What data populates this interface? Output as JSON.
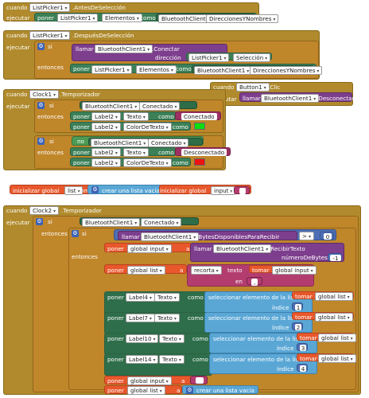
{
  "kw": {
    "cuando": "cuando",
    "ejecutar": "ejecutar",
    "si": "si",
    "entonces": "entonces",
    "poner": "poner",
    "como": "como",
    "a": "a",
    "llamar": "llamar",
    "direccion": "dirección",
    "no": "no",
    "en": "en",
    "indice": "índice",
    "tomar": "tomar",
    "texto": "texto"
  },
  "b1": {
    "comp": "ListPicker1",
    "event": ".AntesDeSelección",
    "set_comp": "ListPicker1",
    "set_prop": "Elementos",
    "val_comp": "BluetoothClient1",
    "val_prop": "DireccionesYNombres"
  },
  "b2": {
    "comp": "ListPicker1",
    "event": ".DespuésDeSelección",
    "call_comp": "BluetoothClient1",
    "call_method": ".Conectar",
    "arg_comp": "ListPicker1",
    "arg_prop": "Selección",
    "set_comp": "ListPicker1",
    "set_prop": "Elementos",
    "val_comp": "BluetoothClient1",
    "val_prop": "DireccionesYNombres"
  },
  "b3": {
    "comp": "Button1",
    "event": ".Clic",
    "call_comp": "BluetoothClient1",
    "call_method": ".Desconectar"
  },
  "b4": {
    "comp": "Clock1",
    "event": ".Temporizador",
    "cond_comp": "BluetoothClient1",
    "cond_prop": "Conectado",
    "lbl": "Label2",
    "p_texto": "Texto",
    "p_color": "ColorDeTexto",
    "s_connected": "Conectado",
    "s_disconnected": "Desconectado",
    "color_ok": "#11dd11",
    "color_bad": "#ee1111"
  },
  "b5": {
    "init_label": "inicializar global",
    "var1": "list",
    "create_empty": "crear una lista vacía",
    "var2": "input"
  },
  "b6": {
    "comp": "Clock2",
    "event": ".Temporizador",
    "cond_comp": "BluetoothClient1",
    "cond_prop": "Conectado",
    "bytes_method": ".BytesDisponiblesParaRecibir",
    "op": ">",
    "zero": "0",
    "g_input": "global input",
    "g_list": "global list",
    "recv_method": ".RecibirTexto",
    "num_bytes": "númeroDeBytes",
    "minus_one": "-1",
    "split": "recorta",
    "split_sep": ",",
    "select_label": "seleccionar elemento de la lista",
    "rows": [
      {
        "label": "Label4",
        "index": "1"
      },
      {
        "label": "Label7",
        "index": "2"
      },
      {
        "label": "Label10",
        "index": "3"
      },
      {
        "label": "Label14",
        "index": "4"
      }
    ],
    "prop": "Texto",
    "empty_list": "crear una lista vacía"
  }
}
